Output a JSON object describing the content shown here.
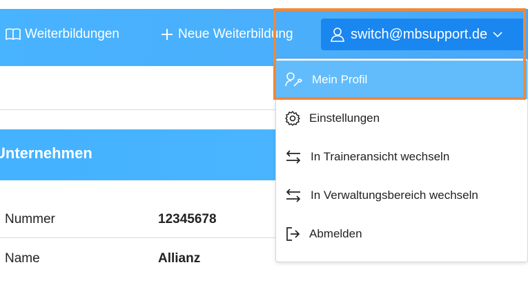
{
  "colors": {
    "topbar": "#4aaefb",
    "user_button": "#1a86f0",
    "active_menu_item": "#62bcfc",
    "highlight_outline": "#f0883a"
  },
  "nav": {
    "weiterbildungen": {
      "label": "Weiterbildungen",
      "icon": "book-icon"
    },
    "neue_weiterbildung": {
      "label": "Neue Weiterbildung",
      "icon": "plus-icon"
    }
  },
  "user_menu": {
    "email": "switch@mbsupport.de",
    "icon": "user-icon",
    "chevron": "chevron-down-icon",
    "items": [
      {
        "label": "Mein Profil",
        "icon": "user-wrench-icon",
        "active": true
      },
      {
        "label": "Einstellungen",
        "icon": "gear-icon",
        "active": false
      },
      {
        "label": "In Traineransicht wechseln",
        "icon": "swap-arrows-icon",
        "active": false
      },
      {
        "label": "In Verwaltungsbereich wechseln",
        "icon": "swap-arrows-icon",
        "active": false
      },
      {
        "label": "Abmelden",
        "icon": "logout-icon",
        "active": false
      }
    ]
  },
  "section": {
    "title": "Unternehmen"
  },
  "details": [
    {
      "label": "Nummer",
      "value": "12345678"
    },
    {
      "label": "Name",
      "value": "Allianz"
    }
  ]
}
